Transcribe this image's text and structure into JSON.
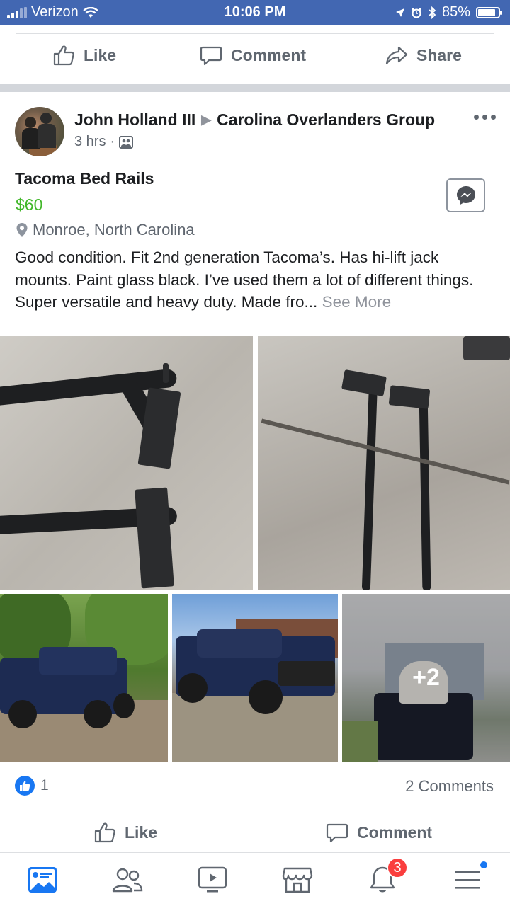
{
  "status_bar": {
    "carrier": "Verizon",
    "time": "10:06 PM",
    "battery": "85%",
    "battery_level": 0.85,
    "icons": [
      "signal-icon",
      "wifi-icon",
      "location-icon",
      "alarm-icon",
      "bluetooth-icon",
      "battery-icon"
    ]
  },
  "top_actions": {
    "like": "Like",
    "comment": "Comment",
    "share": "Share"
  },
  "post": {
    "author": "John Holland III",
    "group": "Carolina Overlanders Group",
    "time": "3 hrs",
    "separator": "·",
    "privacy_icon": "group-privacy-icon",
    "listing": {
      "title": "Tacoma Bed Rails",
      "price": "$60",
      "location": "Monroe, North Carolina"
    },
    "text": "Good condition. Fit 2nd generation Tacoma’s. Has hi-lift jack mounts. Paint glass black. I’ve used them a lot of different things. Super versatile and heavy duty. Made fro...",
    "see_more": "See More",
    "more_photos": "+2",
    "reactions": {
      "like_count": "1",
      "comments": "2 Comments"
    }
  },
  "bottom_actions": {
    "like": "Like",
    "comment": "Comment"
  },
  "tab_bar": {
    "tabs": [
      "news-feed",
      "friends",
      "watch",
      "marketplace",
      "notifications",
      "menu"
    ],
    "notifications_badge": "3"
  },
  "colors": {
    "brand": "#4267b2",
    "price": "#42b72a",
    "badge": "#fa3e3e",
    "like_blue": "#1877f2"
  }
}
